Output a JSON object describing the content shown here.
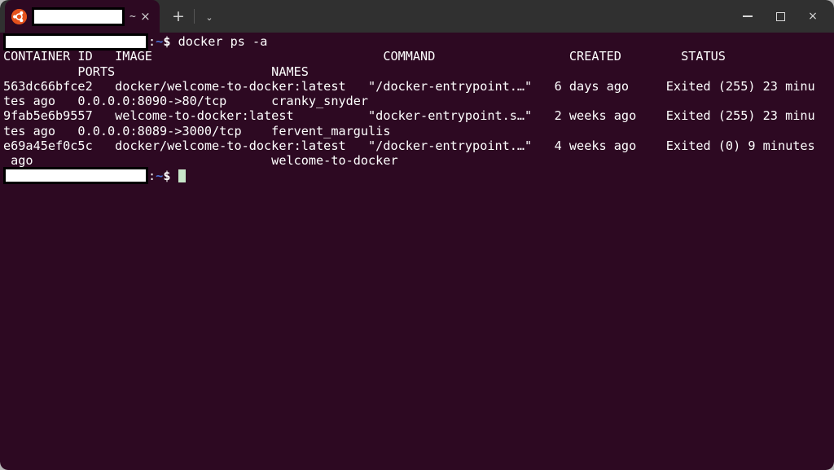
{
  "window": {
    "app": "Terminal",
    "titlebar": {
      "logo_icon": "ubuntu-logo-icon",
      "tab_title_redacted": "",
      "tab_path": "~",
      "tab_close_icon": "×",
      "new_tab_icon": "+",
      "tab_list_icon": "⌄",
      "minimize_icon": "–",
      "maximize_icon": "□",
      "close_icon": "×"
    },
    "colors": {
      "titlebar_bg": "#303030",
      "terminal_bg": "#2d0922",
      "terminal_fg": "#ffffff",
      "tab_active_bg": "#2d0922",
      "ubuntu_orange": "#e4511c",
      "prompt_tilde": "#4a6fd4",
      "cursor": "#c8e6c9",
      "desktop_bg": "#b8b8b8"
    }
  },
  "terminal": {
    "prompt": {
      "user_host_redacted": "",
      "colon": ":",
      "tilde": "~",
      "dollar": "$"
    },
    "command": "docker ps -a",
    "lines": [
      "CONTAINER ID   IMAGE                               COMMAND                  CREATED        STATUS",
      "          PORTS                     NAMES",
      "563dc66bfce2   docker/welcome-to-docker:latest   \"/docker-entrypoint.…\"   6 days ago     Exited (255) 23 minu",
      "tes ago   0.0.0.0:8090->80/tcp      cranky_snyder",
      "9fab5e6b9557   welcome-to-docker:latest          \"docker-entrypoint.s…\"   2 weeks ago    Exited (255) 23 minu",
      "tes ago   0.0.0.0:8089->3000/tcp    fervent_margulis",
      "e69a45ef0c5c   docker/welcome-to-docker:latest   \"/docker-entrypoint.…\"   4 weeks ago    Exited (0) 9 minutes",
      " ago                                welcome-to-docker"
    ],
    "table": {
      "headers": [
        "CONTAINER ID",
        "IMAGE",
        "COMMAND",
        "CREATED",
        "STATUS",
        "PORTS",
        "NAMES"
      ],
      "rows": [
        {
          "container_id": "563dc66bfce2",
          "image": "docker/welcome-to-docker:latest",
          "command": "\"/docker-entrypoint.…\"",
          "created": "6 days ago",
          "status": "Exited (255) 23 minutes ago",
          "ports": "0.0.0.0:8090->80/tcp",
          "names": "cranky_snyder"
        },
        {
          "container_id": "9fab5e6b9557",
          "image": "welcome-to-docker:latest",
          "command": "\"docker-entrypoint.s…\"",
          "created": "2 weeks ago",
          "status": "Exited (255) 23 minutes ago",
          "ports": "0.0.0.0:8089->3000/tcp",
          "names": "fervent_margulis"
        },
        {
          "container_id": "e69a45ef0c5c",
          "image": "docker/welcome-to-docker:latest",
          "command": "\"/docker-entrypoint.…\"",
          "created": "4 weeks ago",
          "status": "Exited (0) 9 minutes ago",
          "ports": "",
          "names": "welcome-to-docker"
        }
      ]
    }
  }
}
